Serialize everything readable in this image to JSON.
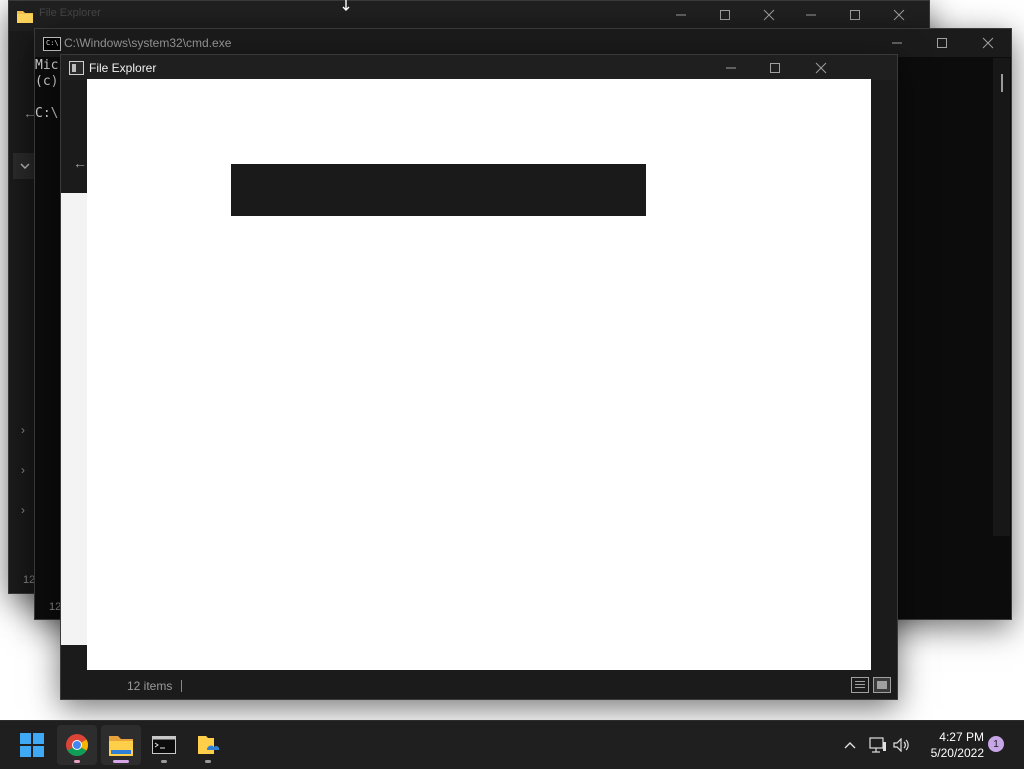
{
  "desktop": {
    "background": "#ffffff"
  },
  "windows": {
    "back_explorer": {
      "title": "File Explorer",
      "status_items": "12"
    },
    "cmd": {
      "title": "C:\\Windows\\system32\\cmd.exe",
      "lines": [
        "Mic",
        "(c)",
        "C:\\"
      ],
      "status_items": "12"
    },
    "front_explorer": {
      "title": "File Explorer",
      "status_items": "12 items"
    }
  },
  "taskbar": {
    "apps": [
      {
        "name": "Start",
        "icon": "windows-start-icon"
      },
      {
        "name": "Google Chrome",
        "icon": "chrome-icon"
      },
      {
        "name": "File Explorer",
        "icon": "folder-icon"
      },
      {
        "name": "Command Prompt",
        "icon": "cmd-icon"
      },
      {
        "name": "OneDrive Folder",
        "icon": "onedrive-folder-icon"
      }
    ],
    "clock": {
      "time": "4:27 PM",
      "date": "5/20/2022"
    },
    "notification_count": "1"
  },
  "colors": {
    "accent": "#0078d4",
    "notification_badge": "#c7a6e8",
    "chrome_indicator": "#e8a0c0"
  }
}
